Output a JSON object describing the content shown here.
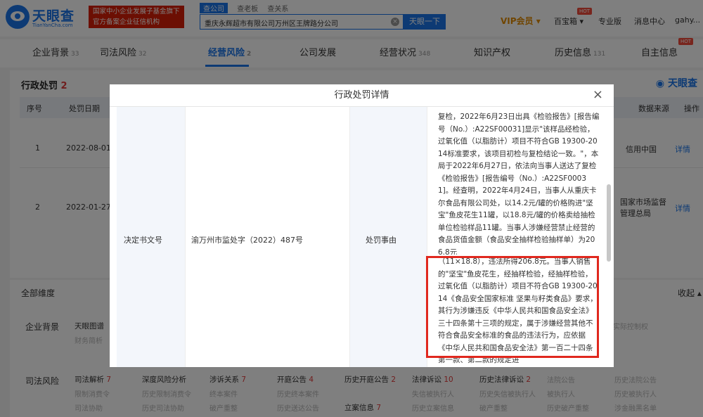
{
  "header": {
    "logo": "天眼查",
    "logo_sub": "TianYanCha.com",
    "banner_l1": "国家中小企业发展子基金旗下",
    "banner_l2": "官方备案企业征信机构",
    "search_tabs": [
      "查公司",
      "查老板",
      "查关系"
    ],
    "search_value": "重庆永辉超市有限公司万州区王牌路分公司",
    "search_btn": "天眼一下",
    "vip": "VIP会员",
    "baibao": "百宝箱",
    "pro": "专业版",
    "msg": "消息中心",
    "user": "gahy..."
  },
  "tabs": [
    {
      "label": "企业背景",
      "count": "33"
    },
    {
      "label": "司法风险",
      "count": "32"
    },
    {
      "label": "经营风险",
      "count": "2"
    },
    {
      "label": "公司发展",
      "count": ""
    },
    {
      "label": "经营状况",
      "count": "348"
    },
    {
      "label": "知识产权",
      "count": ""
    },
    {
      "label": "历史信息",
      "count": "131"
    },
    {
      "label": "自主信息",
      "count": ""
    }
  ],
  "section": {
    "title": "行政处罚",
    "count": "2",
    "watermark": "天眼查",
    "cols": [
      "序号",
      "处罚日期",
      "数据来源",
      "操作"
    ],
    "rows": [
      {
        "no": "1",
        "date": "2022-08-01",
        "source": "信用中国",
        "op": "详情"
      },
      {
        "no": "2",
        "date": "2022-01-27",
        "source": "国家市场监督管理总局",
        "op": "详情"
      }
    ]
  },
  "dims": {
    "title": "全部维度",
    "collapse": "收起",
    "bg_label": "企业背景",
    "bg_item1": "天眼图谱",
    "bg_item1_sub": "财务简析",
    "bg_right": "实际控制权",
    "sf_label": "司法风险",
    "row1": [
      "司法解析",
      "深度风险分析",
      "涉诉关系",
      "开庭公告",
      "历史开庭公告",
      "法律诉讼",
      "历史法律诉讼",
      "法院公告",
      "历史法院公告"
    ],
    "row1_counts": [
      "7",
      "",
      "7",
      "4",
      "2",
      "10",
      "2",
      "",
      ""
    ],
    "row2": [
      "限制消费令",
      "历史限制消费令",
      "终本案件",
      "历史终本案件",
      "失信被执行人",
      "历史失信被执行人",
      "被执行人",
      "历史被执行人"
    ],
    "row3": [
      "司法协助",
      "历史司法协助",
      "破产重整",
      "历史送达公告",
      "立案信息",
      "历史立案信息",
      "破产重整",
      "历史破产重整",
      "涉金融黑名单"
    ],
    "row3_lian_count": "7"
  },
  "modal": {
    "title": "行政处罚详情",
    "label1": "决定书文号",
    "value1": "渝万州市监处字（2022）487号",
    "label2": "处罚事由",
    "reason_top": "复检，2022年6月23日出具《检验报告》[报告编号（No.）:A22SF00031]显示\"该样品经检验，过氧化值（以脂肪计）项目不符合GB 19300-2014标准要求，该项目初检与复检结论一致。\"，本局于2022年6月27日，依法向当事人送达了复检《检验报告》[报告编号（No.）:A22SF00031]。经查明，2022年4月24日，当事人从重庆卡尔食品有限公司处，以14.2元/罐的价格购进\"坚宝\"鱼皮花生11罐，以18.8元/罐的价格卖给抽检单位检验样品11罐。当事人涉嫌经营禁止经营的食品货值金额（食品安全抽样检验抽样单）为206.8元",
    "reason_bottom": "（11×18.8），违法所得206.8元。当事人销售的\"坚宝\"鱼皮花生，经抽样检验，经抽样检验，过氧化值（以脂肪计）项目不符合GB 19300-2014《食品安全国家标准 坚果与籽类食品》要求，其行为涉嫌违反《中华人民共和国食品安全法》三十四条第十三项的规定，属于涉嫌经营其他不符合食品安全标准的食品的违法行为，应依据《中华人民共和国食品安全法》第一百二十四条第一款、第二款的规定进"
  }
}
